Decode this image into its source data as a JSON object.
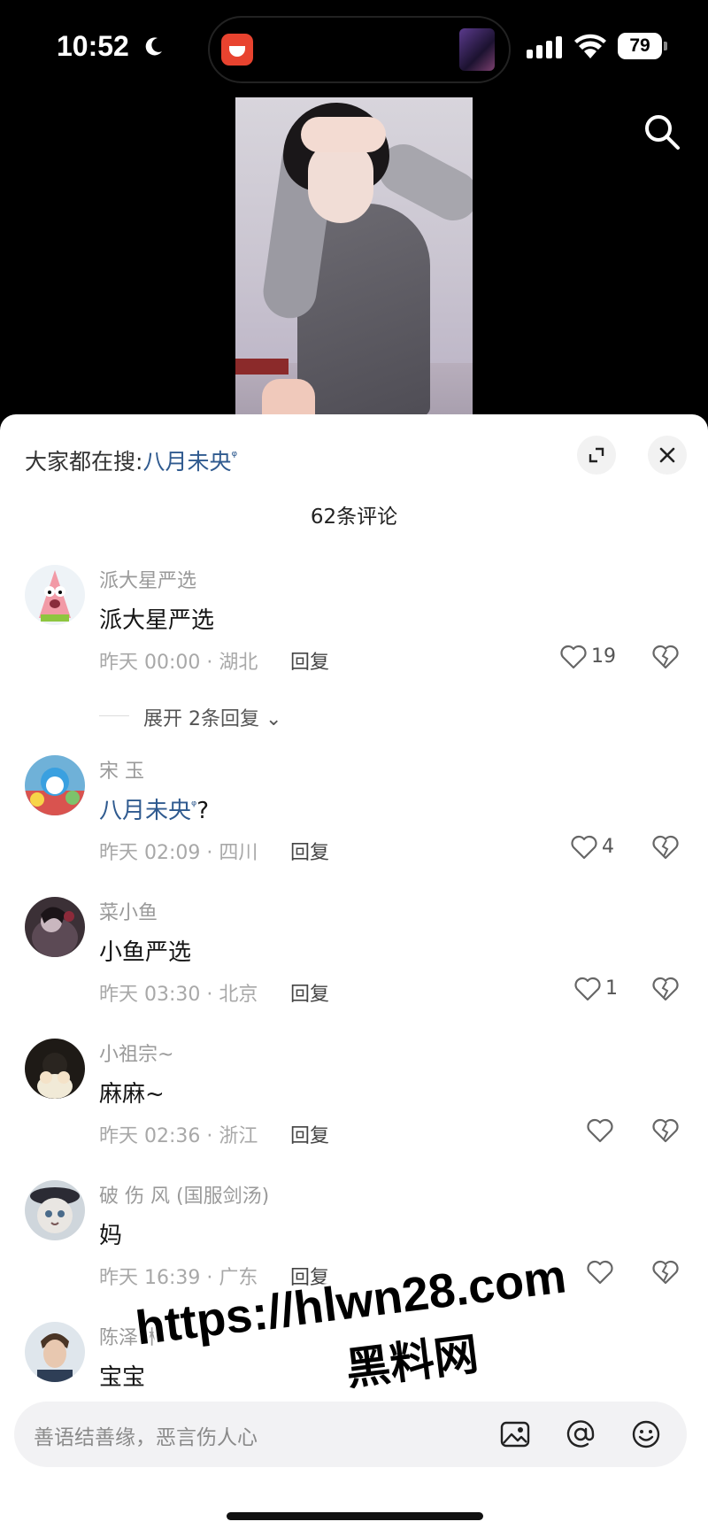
{
  "status_bar": {
    "time": "10:52",
    "battery": "79",
    "icons": [
      "moon-icon",
      "signal-icon",
      "wifi-icon",
      "battery-icon"
    ]
  },
  "trending": {
    "prefix": "大家都在搜:",
    "keyword": "八月未央",
    "search_mark": "ᵠ"
  },
  "comments_header": {
    "count_label": "62条评论"
  },
  "comments": [
    {
      "username": "派大星严选",
      "text": "派大星严选",
      "meta": "昨天 00:00 · 湖北",
      "reply_label": "回复",
      "likes": "19",
      "more_replies": "展开 2条回复 ⌄"
    },
    {
      "username": "宋 玉",
      "text_keyword": "八月未央",
      "text_suffix": "?",
      "meta": "昨天 02:09 · 四川",
      "reply_label": "回复",
      "likes": "4"
    },
    {
      "username": "菜小鱼",
      "text": "小鱼严选",
      "meta": "昨天 03:30 · 北京",
      "reply_label": "回复",
      "likes": "1"
    },
    {
      "username": "小祖宗~",
      "text": "麻麻~",
      "meta": "昨天 02:36 · 浙江",
      "reply_label": "回复",
      "likes": ""
    },
    {
      "username": "破 伤 风 (国服剑汤)",
      "text": "妈",
      "meta": "昨天 16:39 · 广东",
      "reply_label": "回复",
      "likes": ""
    },
    {
      "username": "陈泽林",
      "text": "宝宝"
    }
  ],
  "input_bar": {
    "placeholder": "善语结善缘，恶言伤人心",
    "icons": [
      "image-icon",
      "at-icon",
      "emoji-icon"
    ]
  },
  "watermark": {
    "url": "https://hlwn28.com",
    "site_name": "黑料网"
  },
  "colors": {
    "accent_link": "#2f5a8f",
    "sheet_bg": "#ffffff",
    "page_bg": "#000000"
  }
}
